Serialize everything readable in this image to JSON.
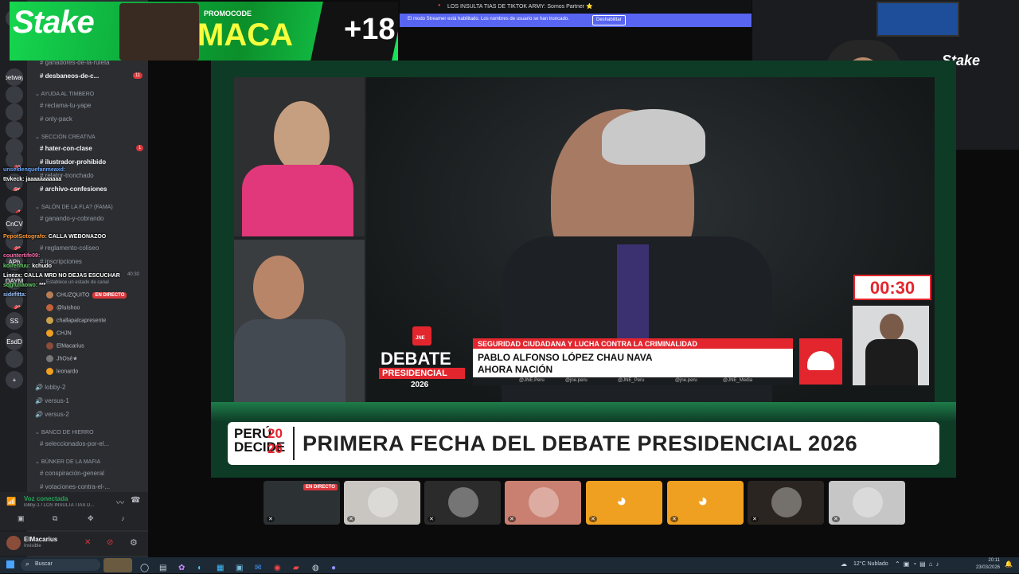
{
  "banner": {
    "brand": "Stake",
    "promo_label": "PROMOCODE",
    "promo_code": "MACA",
    "age": "+18"
  },
  "top_notice": {
    "now_playing": "LOS INSULTA TIAS DE TIKTOK ARMY: Somos Partner ⭐",
    "streamer_mode_text": "El modo Streamer está habilitado. Los nombres de usuario se han truncado.",
    "disable_button": "Deshabilitar"
  },
  "servers": [
    {
      "label": "N",
      "badge": ""
    },
    {
      "label": "betway",
      "badge": ""
    },
    {
      "label": "",
      "badge": ""
    },
    {
      "label": "",
      "badge": "4"
    },
    {
      "label": "",
      "badge": ""
    },
    {
      "label": "",
      "badge": ""
    },
    {
      "label": "",
      "badge": "337"
    },
    {
      "label": "",
      "badge": "5K+"
    },
    {
      "label": "",
      "badge": "16"
    },
    {
      "label": "CnCV",
      "badge": ""
    },
    {
      "label": "",
      "badge": "224"
    },
    {
      "label": "APh",
      "badge": ""
    },
    {
      "label": "DAYM",
      "badge": ""
    },
    {
      "label": "",
      "badge": "220"
    },
    {
      "label": "SS",
      "badge": ""
    },
    {
      "label": "EsdD",
      "badge": ""
    },
    {
      "label": "",
      "badge": ""
    },
    {
      "label": "+",
      "badge": ""
    }
  ],
  "channels": {
    "top_channels": [
      {
        "name": "ganadores-de-la-ruleta",
        "bold": false
      },
      {
        "name": "desbaneos-de-c...",
        "bold": true,
        "badge": "11"
      }
    ],
    "cat_ayuda": "AYUDA AL TIMBERO",
    "ayuda_channels": [
      "reclama-tu-yape",
      "only-pack"
    ],
    "cat_creativa": "SECCIÓN CREATIVA",
    "creativa_channels": [
      {
        "name": "hater-con-clase",
        "bold": true,
        "badge": "1"
      },
      {
        "name": "ilustrador-prohibido",
        "bold": true
      },
      {
        "name": "relator-tronchado",
        "bold": false
      },
      {
        "name": "archivo-confesiones",
        "bold": true
      }
    ],
    "cat_salon": "SALÓN DE LA FLA? (FAMA)",
    "salon_channels": [
      "ganando-y-cobrando"
    ],
    "more_channels": [
      "reglamento-coliseo",
      "inscripciones"
    ],
    "voice_status": "Establece un estado de canal",
    "voice_timer": "40:30",
    "voice_users": [
      {
        "name": "CHUZQUITO",
        "live": "EN DIRECTO",
        "color": "#b87d55"
      },
      {
        "name": "@luishoo",
        "color": "#c0623b"
      },
      {
        "name": "challapalcapresente",
        "color": "#caa24c"
      },
      {
        "name": "CHJN",
        "color": "#f0a020"
      },
      {
        "name": "ElMacarius",
        "color": "#8a4d3a"
      },
      {
        "name": "JhOsé★",
        "color": "#777777"
      },
      {
        "name": "leonardo",
        "color": "#f0a020"
      }
    ],
    "voice_channels": [
      "lobby-2",
      "versus-1",
      "versus-2"
    ],
    "cat_hierro": "BANCO DE HIERRO",
    "hierro_channels": [
      "seleccionados-por-el..."
    ],
    "cat_mafia": "BÚNKER DE LA MAFIA",
    "mafia_channels": [
      "conspiración-general",
      "votaciones-contra-el-..."
    ]
  },
  "voice_panel": {
    "status": "Voz conectada",
    "location": "lobby-1 / LOS INSULTA TIAS D..."
  },
  "user_panel": {
    "name": "ElMacarius",
    "status": "Invisible"
  },
  "chat_overlay": [
    {
      "user": "unseldenquefanmeaxd:",
      "msg": "",
      "color": "#6aa8ff"
    },
    {
      "user": "ttvkeck:",
      "msg": "jaaaaaaaaaaa",
      "color": "#ffffff"
    },
    {
      "user": "PepotSotografo:",
      "msg": "CALLA WEBONAZOO",
      "color": "#ff9b3a"
    },
    {
      "user": "countertife09:",
      "msg": "",
      "color": "#ff6fb0"
    },
    {
      "user": "koirenfuu:",
      "msg": "kchudo",
      "color": "#69d36b"
    },
    {
      "user": "Linezx:",
      "msg": "CALLA MRD NO DEJAS ESCUCHAR",
      "color": "#ffffff"
    },
    {
      "user": "sqgfuliaowo:",
      "msg": "***",
      "color": "#69d36b"
    },
    {
      "user": "sidefitta:",
      "msg": "",
      "color": "#9ac3ff"
    }
  ],
  "broadcast": {
    "countdown": "00:30",
    "topic": "SEGURIDAD CIUDADANA Y LUCHA CONTRA LA CRIMINALIDAD",
    "candidate": "PABLO ALFONSO LÓPEZ CHAU NAVA",
    "party": "AHORA NACIÓN",
    "debate_word": "DEBATE",
    "debate_sub": "PRESIDENCIAL",
    "debate_year": "2026",
    "jne": "JNE",
    "socials": [
      "@JNE.Peru",
      "@jne.peru",
      "@JNE_Peru",
      "@jne.peru",
      "@JNE_Media"
    ],
    "peru_decide": "PERÚ DECIDE",
    "peru_year_a": "20",
    "peru_year_b": "26",
    "headline": "PRIMERA FECHA DEL DEBATE PRESIDENCIAL 2026"
  },
  "webcam": {
    "brand": "Stake"
  },
  "thumbs": [
    {
      "kind": "stream",
      "live": "EN DIRECTO",
      "color": "#2c3134"
    },
    {
      "kind": "avatar",
      "color": "#c9c6c1"
    },
    {
      "kind": "avatar",
      "color": "#2b2b2b"
    },
    {
      "kind": "avatar",
      "color": "#c98070"
    },
    {
      "kind": "discord",
      "color": "#f0a020"
    },
    {
      "kind": "discord",
      "color": "#f0a020"
    },
    {
      "kind": "avatar",
      "color": "#2a2520"
    },
    {
      "kind": "avatar",
      "color": "#c6c6c6"
    }
  ],
  "taskbar": {
    "search": "Buscar",
    "weather": "12°C  Nublado",
    "time": "20:11",
    "date": "23/03/2026"
  },
  "colors": {
    "discord_bg": "#2b2d31",
    "stage_green": "#0e3b26",
    "stake_green": "#14e05a",
    "debate_red": "#e3262e",
    "blurple": "#5865f2"
  }
}
